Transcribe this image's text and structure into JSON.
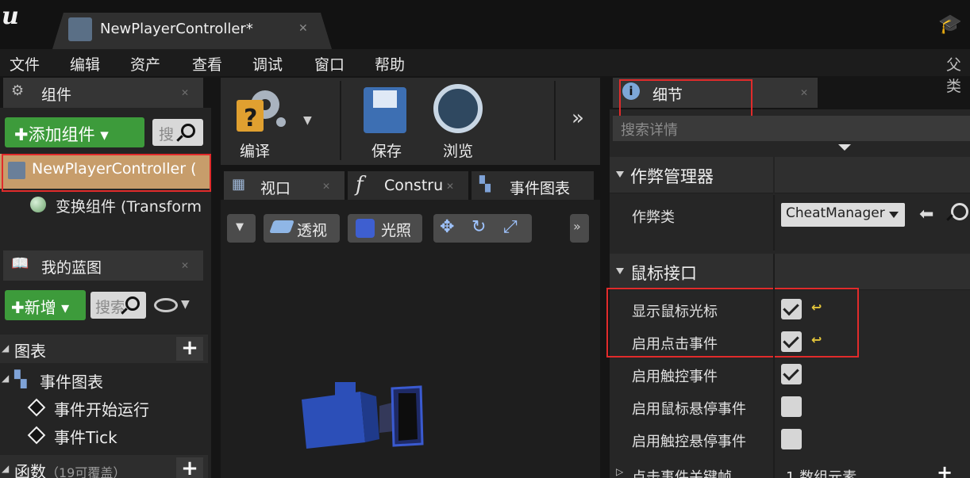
{
  "app": {
    "document_tab": "NewPlayerController*",
    "menu": [
      "文件",
      "编辑",
      "资产",
      "查看",
      "调试",
      "窗口",
      "帮助"
    ],
    "menu_right": "父类"
  },
  "components_panel": {
    "tab_label": "组件",
    "add_button": "添加组件",
    "search_placeholder": "搜",
    "root_item": "NewPlayerController (",
    "child_item": "变换组件 (Transform"
  },
  "my_blueprint": {
    "tab_label": "我的蓝图",
    "new_button": "新增",
    "search_placeholder": "搜索",
    "graphs_section": "图表",
    "event_graph": "事件图表",
    "event_begin": "事件开始运行",
    "event_tick": "事件Tick",
    "functions_section": "函数",
    "functions_hint": "（19可覆盖）"
  },
  "toolbar": {
    "compile_label": "编译",
    "save_label": "保存",
    "browse_label": "浏览"
  },
  "editor_tabs": {
    "viewport": "视口",
    "construction": "Constru",
    "event_graph": "事件图表"
  },
  "viewport": {
    "perspective_label": "透视",
    "lighting_label": "光照"
  },
  "details_panel": {
    "tab_label": "细节",
    "search_placeholder": "搜索详情",
    "cheat_category": "作弊管理器",
    "cheat_class_label": "作弊类",
    "cheat_class_value": "CheatManager",
    "mouse_category": "鼠标接口",
    "properties": [
      {
        "label": "显示鼠标光标",
        "checked": true,
        "reset": true
      },
      {
        "label": "启用点击事件",
        "checked": true,
        "reset": true
      },
      {
        "label": "启用触控事件",
        "checked": true,
        "reset": false
      },
      {
        "label": "启用鼠标悬停事件",
        "checked": false,
        "reset": false
      },
      {
        "label": "启用触控悬停事件",
        "checked": false,
        "reset": false
      }
    ],
    "click_keys_label": "点击事件关键帧",
    "click_keys_value": "1 数组元素"
  },
  "colors": {
    "green_button": "#3d9b3b",
    "selected_item": "#c79d6b",
    "highlight_box": "#e12b2b",
    "reset_arrow": "#e3c53a"
  }
}
